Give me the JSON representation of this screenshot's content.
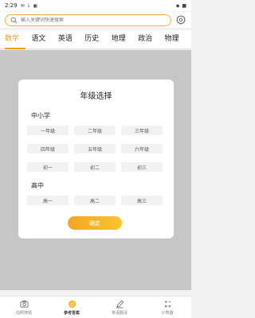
{
  "status_bar": {
    "time": "2:29",
    "battery": "■"
  },
  "search": {
    "placeholder": "输入关键词快速搜索"
  },
  "subject_tabs": [
    "数学",
    "语文",
    "英语",
    "历史",
    "地理",
    "政治",
    "物理"
  ],
  "active_tab_index": 0,
  "dialog": {
    "title": "年级选择",
    "sections": [
      {
        "label": "中小学",
        "grades": [
          "一年级",
          "二年级",
          "三年级",
          "四年级",
          "五年级",
          "六年级",
          "初一",
          "初二",
          "初三"
        ]
      },
      {
        "label": "高中",
        "grades": [
          "高一",
          "高二",
          "高三"
        ]
      }
    ],
    "confirm_label": "确定"
  },
  "bottom_nav": [
    {
      "label": "拍照搜题",
      "icon": "camera-icon"
    },
    {
      "label": "参考答案",
      "icon": "answer-icon"
    },
    {
      "label": "英语翻译",
      "icon": "pen-icon"
    },
    {
      "label": "计算器",
      "icon": "calculator-icon"
    }
  ],
  "active_nav_index": 1,
  "colors": {
    "accent": "#f0a020",
    "search_border": "#f0b43c",
    "confirm_start": "#f5a623",
    "confirm_end": "#f7c530"
  }
}
